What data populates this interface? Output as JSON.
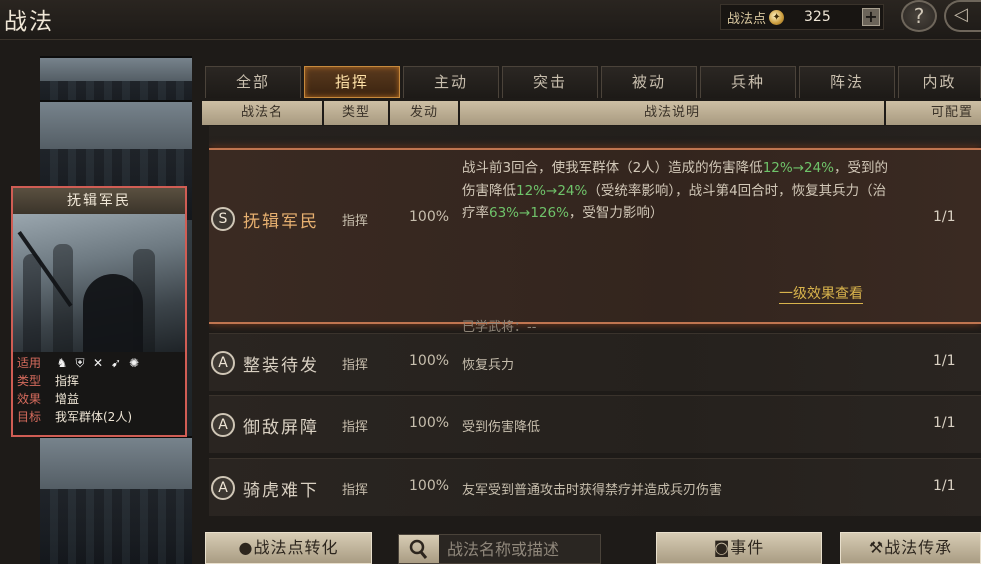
{
  "header": {
    "title": "战法",
    "points_label": "战法点",
    "points_icon": "coin-icon",
    "points_value": "325",
    "plus_label": "+",
    "help_label": "?"
  },
  "card": {
    "name": "抚辑军民",
    "aptitude_label": "适用",
    "aptitude_icons": [
      "cavalry-icon",
      "shield-icon",
      "spear-icon",
      "bow-icon",
      "siege-icon"
    ],
    "type_label": "类型",
    "type_value": "指挥",
    "effect_label": "效果",
    "effect_value": "增益",
    "target_label": "目标",
    "target_value": "我军群体(2人)"
  },
  "tabs": [
    {
      "label": "全部",
      "active": false
    },
    {
      "label": "指挥",
      "active": true
    },
    {
      "label": "主动",
      "active": false
    },
    {
      "label": "突击",
      "active": false
    },
    {
      "label": "被动",
      "active": false
    },
    {
      "label": "兵种",
      "active": false
    },
    {
      "label": "阵法",
      "active": false
    },
    {
      "label": "内政",
      "active": false
    }
  ],
  "columns": {
    "name": "战法名",
    "type": "类型",
    "trigger": "发动",
    "desc": "战法说明",
    "config": "可配置"
  },
  "selected": {
    "grade": "S",
    "name": "抚辑军民",
    "type": "指挥",
    "rate": "100%",
    "count": "1/1",
    "desc_parts": [
      {
        "t": "战斗前3回合，使我军群体（2人）造成的伤害降低",
        "g": false
      },
      {
        "t": "12%→24%",
        "g": true
      },
      {
        "t": "，受到的伤害降低",
        "g": false
      },
      {
        "t": "12%→24%",
        "g": true
      },
      {
        "t": "（受统率影响），战斗第4回合时，恢复其兵力（治疗率",
        "g": false
      },
      {
        "t": "63%→126%",
        "g": true
      },
      {
        "t": "，受智力影响）",
        "g": false
      }
    ],
    "effect_link": "一级效果查看",
    "learned": "已学武将：--"
  },
  "rows": [
    {
      "grade": "A",
      "name": "整装待发",
      "type": "指挥",
      "rate": "100%",
      "desc": "恢复兵力",
      "count": "1/1"
    },
    {
      "grade": "A",
      "name": "御敌屏障",
      "type": "指挥",
      "rate": "100%",
      "desc": "受到伤害降低",
      "count": "1/1"
    },
    {
      "grade": "A",
      "name": "骑虎难下",
      "type": "指挥",
      "rate": "100%",
      "desc": "友军受到普通攻击时获得禁疗并造成兵刃伤害",
      "count": "1/1"
    }
  ],
  "bottom": {
    "convert_label": "战法点转化",
    "search_placeholder": "战法名称或描述",
    "events_label": "事件",
    "inherit_label": "战法传承"
  }
}
